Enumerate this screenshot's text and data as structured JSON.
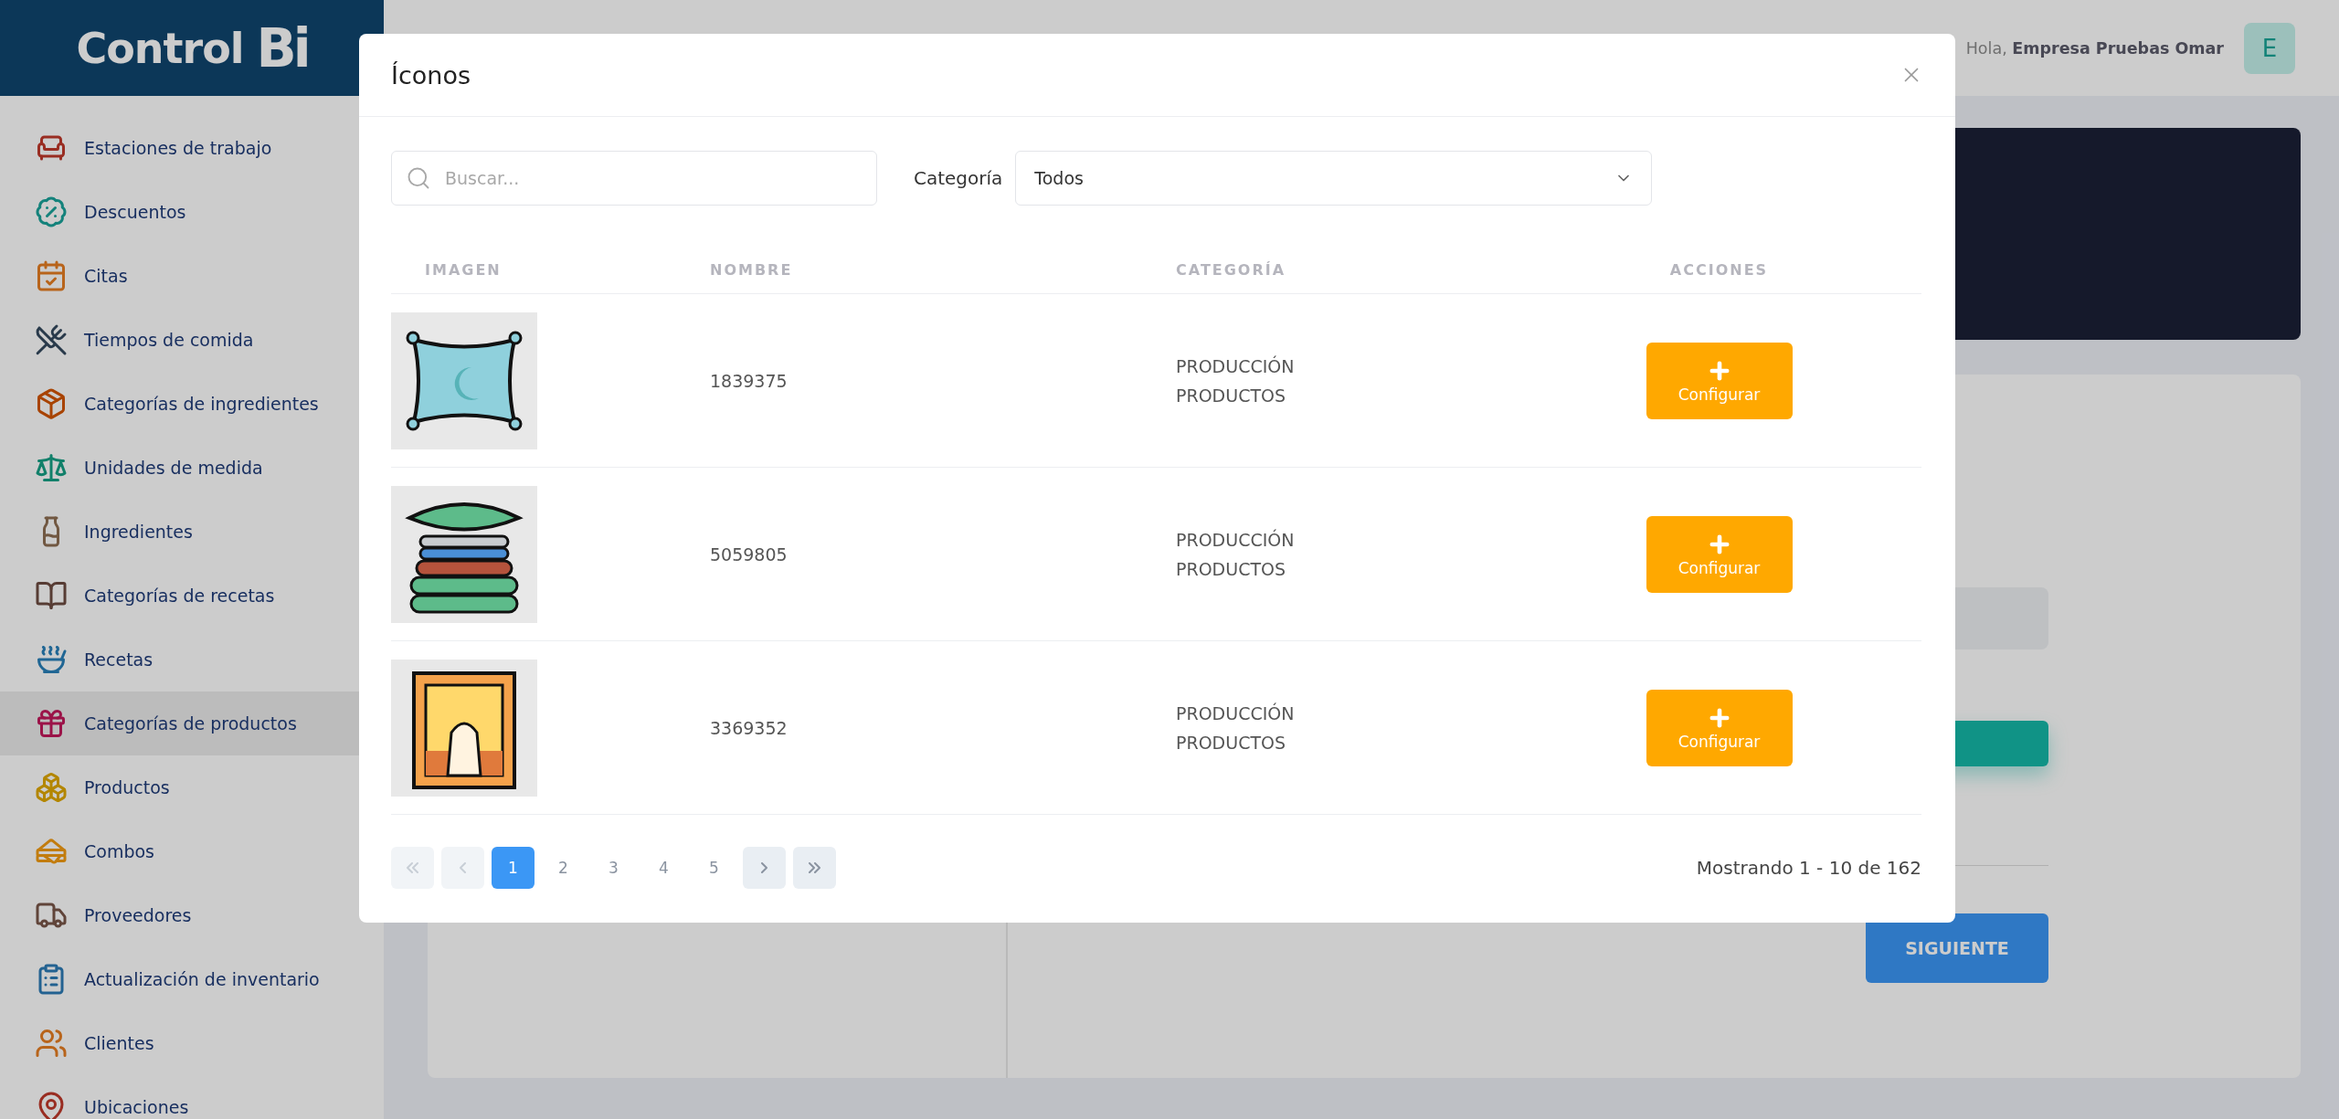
{
  "logo": {
    "text": "Control",
    "mark": "Bi"
  },
  "sidebar": {
    "items": [
      {
        "label": "Estaciones de trabajo",
        "selected": false
      },
      {
        "label": "Descuentos",
        "selected": false
      },
      {
        "label": "Citas",
        "selected": false
      },
      {
        "label": "Tiempos de comida",
        "selected": false
      },
      {
        "label": "Categorías de ingredientes",
        "selected": false
      },
      {
        "label": "Unidades de medida",
        "selected": false
      },
      {
        "label": "Ingredientes",
        "selected": false
      },
      {
        "label": "Categorías de recetas",
        "selected": false
      },
      {
        "label": "Recetas",
        "selected": false
      },
      {
        "label": "Categorías de productos",
        "selected": true
      },
      {
        "label": "Productos",
        "selected": false
      },
      {
        "label": "Combos",
        "selected": false
      },
      {
        "label": "Proveedores",
        "selected": false
      },
      {
        "label": "Actualización de inventario",
        "selected": false
      },
      {
        "label": "Clientes",
        "selected": false
      },
      {
        "label": "Ubicaciones",
        "selected": false
      }
    ]
  },
  "header": {
    "greeting": "Hola, **Empresa Pruebas Omar**",
    "avatar": "E"
  },
  "background_form": {
    "next_button": "SIGUIENTE"
  },
  "modal": {
    "title": "Íconos",
    "search": {
      "placeholder": "Buscar..."
    },
    "category_filter": {
      "label": "Categoría",
      "value": "Todos"
    },
    "table": {
      "columns": [
        "IMAGEN",
        "NOMBRE",
        "CATEGORÍA",
        "ACCIONES"
      ],
      "rows": [
        {
          "nombre": "1839375",
          "categoria": "PRODUCCIÓN PRODUCTOS",
          "action": "Configurar"
        },
        {
          "nombre": "5059805",
          "categoria": "PRODUCCIÓN PRODUCTOS",
          "action": "Configurar"
        },
        {
          "nombre": "3369352",
          "categoria": "PRODUCCIÓN PRODUCTOS",
          "action": "Configurar"
        }
      ]
    },
    "pagination": {
      "items": [
        {
          "kind": "first",
          "disabled": true
        },
        {
          "kind": "prev",
          "disabled": true
        },
        {
          "kind": "page",
          "label": "1",
          "selected": true
        },
        {
          "kind": "page",
          "label": "2",
          "selected": false
        },
        {
          "kind": "page",
          "label": "3",
          "selected": false
        },
        {
          "kind": "page",
          "label": "4",
          "selected": false
        },
        {
          "kind": "page",
          "label": "5",
          "selected": false
        },
        {
          "kind": "next",
          "disabled": false
        },
        {
          "kind": "last",
          "disabled": false
        }
      ],
      "summary": "Mostrando 1 - 10 de 162"
    }
  }
}
